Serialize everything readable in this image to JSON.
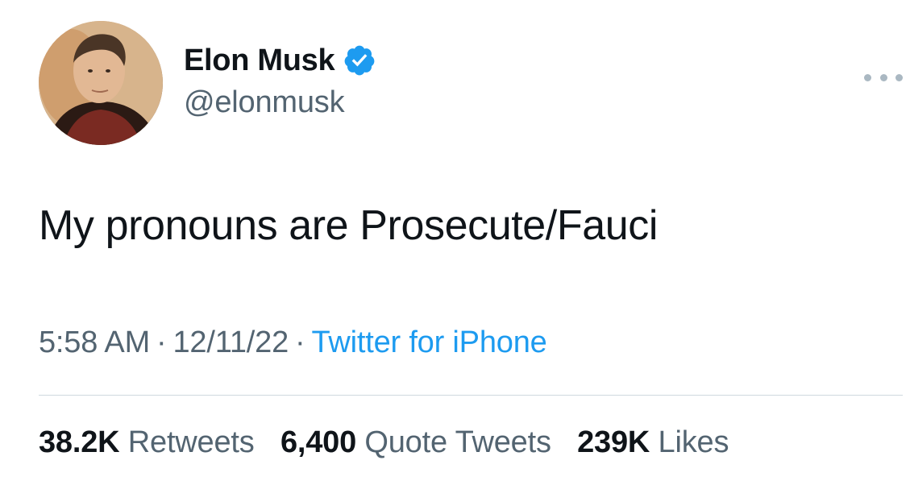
{
  "user": {
    "display_name": "Elon Musk",
    "handle": "@elonmusk",
    "verified_icon": "verified-badge-icon",
    "avatar_icon": "profile-photo"
  },
  "menu": {
    "more_icon": "more-horizontal-icon"
  },
  "tweet": {
    "text": "My pronouns are Prosecute/Fauci",
    "time": "5:58 AM",
    "separator": "·",
    "date": "12/11/22",
    "source": "Twitter for iPhone"
  },
  "stats": {
    "retweets_count": "38.2K",
    "retweets_label": "Retweets",
    "quotes_count": "6,400",
    "quotes_label": "Quote Tweets",
    "likes_count": "239K",
    "likes_label": "Likes"
  },
  "colors": {
    "text_primary": "#0f1419",
    "text_secondary": "#536471",
    "link": "#1d9bf0",
    "verified": "#1d9bf0",
    "divider": "#cfd9de"
  }
}
